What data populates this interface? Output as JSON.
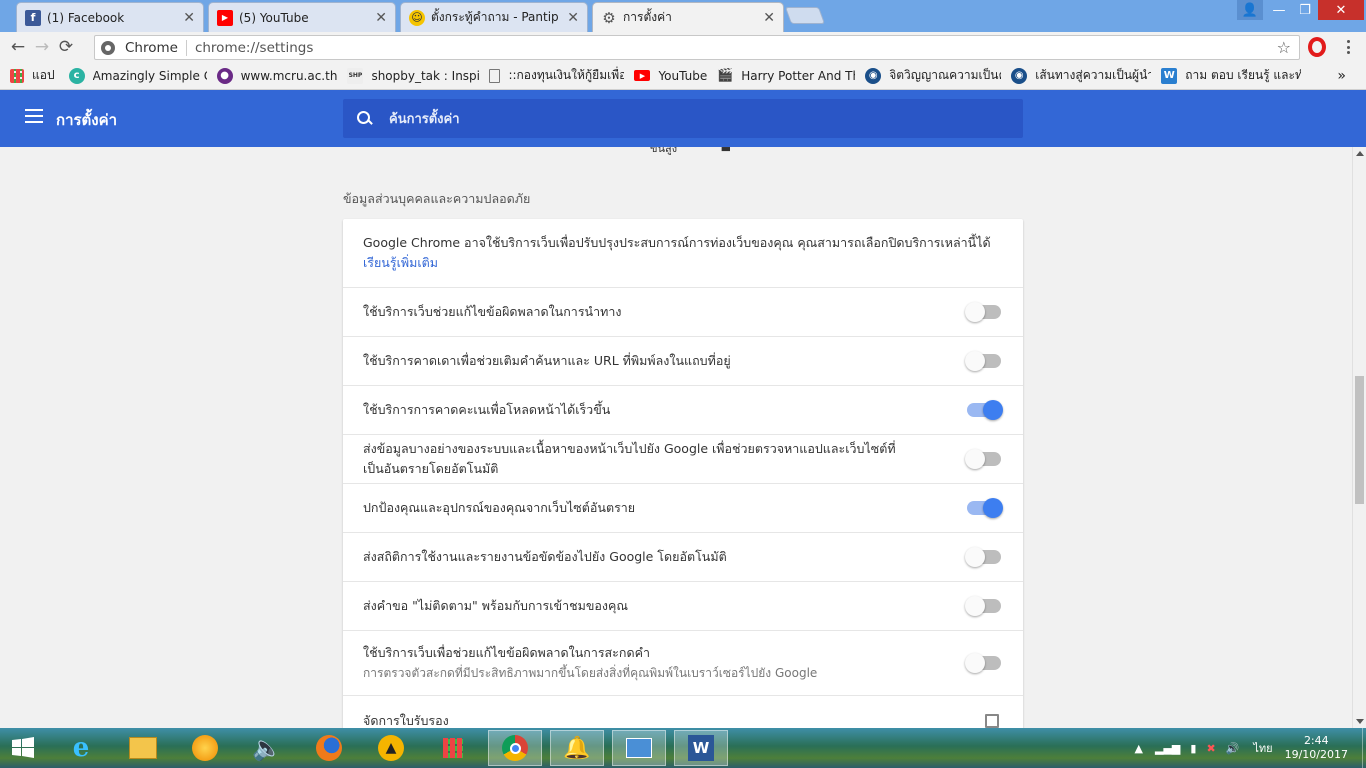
{
  "browser": {
    "tabs": [
      {
        "title": "(1) Facebook",
        "favicon": "facebook-icon",
        "color": "#3b5998"
      },
      {
        "title": "(5) YouTube",
        "favicon": "youtube-icon",
        "color": "#ff0000"
      },
      {
        "title": "ตั้งกระทู้คำถาม - Pantip",
        "favicon": "pantip-icon",
        "color": "#f5c400"
      },
      {
        "title": "การตั้งค่า",
        "favicon": "gear-icon",
        "color": "#555555"
      }
    ],
    "omnibox": {
      "chip": "Chrome",
      "url": "chrome://settings"
    },
    "bookmarks": [
      {
        "label": "แอป",
        "icon": "apps-grid-icon"
      },
      {
        "label": "Amazingly Simple Gra",
        "icon": "c-circle-icon"
      },
      {
        "label": "www.mcru.ac.th",
        "icon": "mcru-logo-icon"
      },
      {
        "label": "shopby_tak : Inspired",
        "icon": "shopby-icon"
      },
      {
        "label": "::กองทุนเงินให้กู้ยืมเพื่อการ",
        "icon": "document-icon"
      },
      {
        "label": "YouTube",
        "icon": "youtube-icon"
      },
      {
        "label": "Harry Potter And The",
        "icon": "clapperboard-icon"
      },
      {
        "label": "จิตวิญญาณความเป็นครู",
        "icon": "globe-icon"
      },
      {
        "label": "เส้นทางสู่ความเป็นผู้นำทา",
        "icon": "globe-icon"
      },
      {
        "label": "ถาม ตอบ เรียนรู้ และทำแบ",
        "icon": "wiki-icon"
      }
    ],
    "bookmarks_overflow": "»"
  },
  "settings_header": {
    "title": "การตั้งค่า",
    "search_placeholder": "ค้นการตั้งค่า"
  },
  "content": {
    "partial_heading": "ขั้นสูง",
    "section_title": "ข้อมูลส่วนบุคคลและความปลอดภัย",
    "intro_text": "Google Chrome อาจใช้บริการเว็บเพื่อปรับปรุงประสบการณ์การท่องเว็บของคุณ คุณสามารถเลือกปิดบริการเหล่านี้ได้ ",
    "intro_link": "เรียนรู้เพิ่มเติม",
    "settings": [
      {
        "label": "ใช้บริการเว็บช่วยแก้ไขข้อผิดพลาดในการนำทาง",
        "on": false
      },
      {
        "label": "ใช้บริการคาดเดาเพื่อช่วยเติมคำค้นหาและ URL ที่พิมพ์ลงในแถบที่อยู่",
        "on": false
      },
      {
        "label": "ใช้บริการการคาดคะเนเพื่อโหลดหน้าได้เร็วขึ้น",
        "on": true
      },
      {
        "label": "ส่งข้อมูลบางอย่างของระบบและเนื้อหาของหน้าเว็บไปยัง Google เพื่อช่วยตรวจหาแอปและเว็บไซต์ที่เป็นอันตรายโดยอัตโนมัติ",
        "on": false
      },
      {
        "label": "ปกป้องคุณและอุปกรณ์ของคุณจากเว็บไซต์อันตราย",
        "on": true
      },
      {
        "label": "ส่งสถิติการใช้งานและรายงานข้อขัดข้องไปยัง Google โดยอัตโนมัติ",
        "on": false
      },
      {
        "label": "ส่งคำขอ \"ไม่ติดตาม\" พร้อมกับการเข้าชมของคุณ",
        "on": false
      },
      {
        "label": "ใช้บริการเว็บเพื่อช่วยแก้ไขข้อผิดพลาดในการสะกดคำ",
        "sub": "การตรวจตัวสะกดที่มีประสิทธิภาพมากขึ้นโดยส่งสิ่งที่คุณพิมพ์ในเบราว์เซอร์ไปยัง Google",
        "on": false
      }
    ],
    "manage_certs": "จัดการใบรับรอง"
  },
  "taskbar": {
    "apps": [
      "internet-explorer-icon",
      "file-explorer-icon",
      "media-icon",
      "speaker-app-icon",
      "firefox-icon",
      "vlc-icon",
      "start-grid-icon",
      "chrome-icon",
      "bell-icon",
      "control-panel-icon",
      "word-icon"
    ],
    "lang": "ไทย",
    "time": "2:44",
    "date": "19/10/2017"
  }
}
